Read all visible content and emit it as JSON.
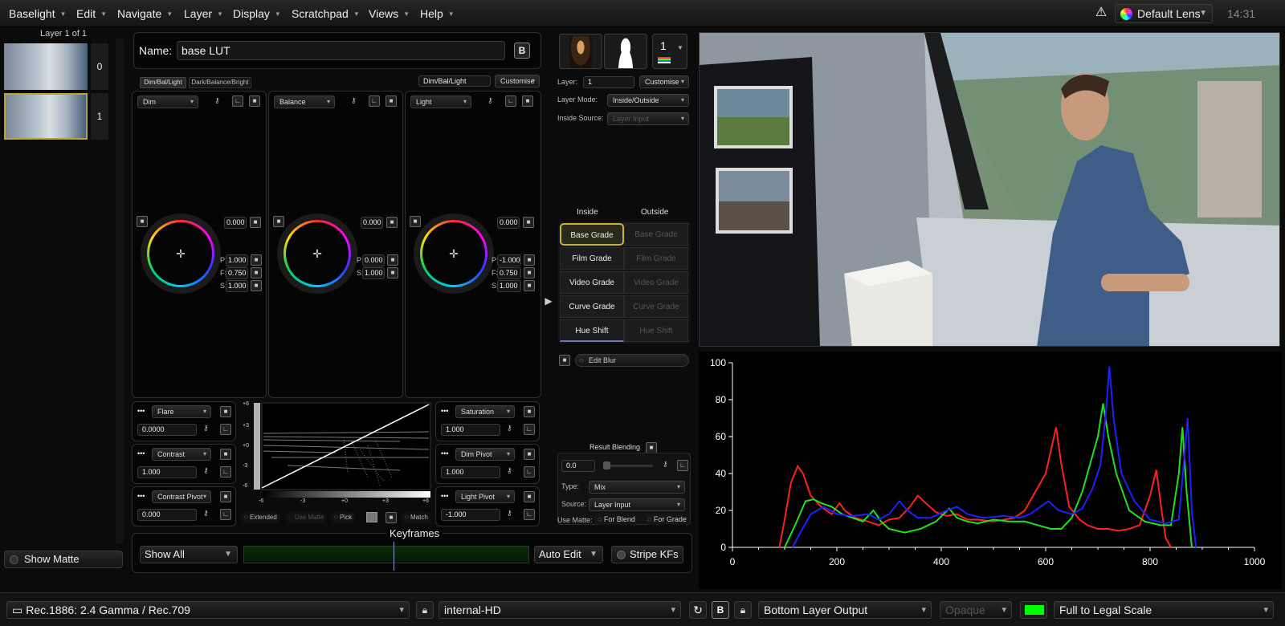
{
  "menubar": {
    "items": [
      "Baselight",
      "Edit",
      "Navigate",
      "Layer",
      "Display",
      "Scratchpad",
      "Views",
      "Help"
    ],
    "lens": "Default Lens",
    "clock": "14:31"
  },
  "layers": {
    "header": "Layer 1 of 1",
    "thumbs": [
      {
        "num": "0"
      },
      {
        "num": "1"
      }
    ],
    "show_matte": "Show Matte"
  },
  "name_field": {
    "label": "Name:",
    "value": "base LUT",
    "btn": "B"
  },
  "grade": {
    "tabs": [
      "Dim/Bal/Light",
      "Dark/Balance/Bright"
    ],
    "preset": "Dim/Bal/Light",
    "customise": "Customise",
    "wheels": [
      {
        "title": "Dim",
        "value": "0.000",
        "params": [
          {
            "k": "P:",
            "v": "1.000"
          },
          {
            "k": "F:",
            "v": "0.750"
          },
          {
            "k": "S:",
            "v": "1.000"
          }
        ]
      },
      {
        "title": "Balance",
        "value": "0.000",
        "params": [
          {
            "k": "P:",
            "v": "0.000"
          },
          {
            "k": "S:",
            "v": "1.000"
          }
        ]
      },
      {
        "title": "Light",
        "value": "0.000",
        "params": [
          {
            "k": "P:",
            "v": "-1.000"
          },
          {
            "k": "F:",
            "v": "0.750"
          },
          {
            "k": "S:",
            "v": "1.000"
          }
        ]
      }
    ],
    "left_params": [
      {
        "name": "Flare",
        "value": "0.0000"
      },
      {
        "name": "Contrast",
        "value": "1.000"
      },
      {
        "name": "Contrast Pivot",
        "value": "0.000"
      }
    ],
    "right_params": [
      {
        "name": "Saturation",
        "value": "1.000"
      },
      {
        "name": "Dim Pivot",
        "value": "1.000"
      },
      {
        "name": "Light Pivot",
        "value": "-1.000"
      }
    ],
    "curve": {
      "y_ticks": [
        "+6",
        "+3",
        "+0",
        "-3",
        "-6"
      ],
      "x_ticks": [
        "-6",
        "-3",
        "+0",
        "+3",
        "+6"
      ]
    },
    "curve_btns": [
      "Extended",
      "Use Matte",
      "Pick",
      "Match"
    ]
  },
  "keyframes": {
    "label": "Keyframes",
    "show": "Show All",
    "auto_edit": "Auto Edit",
    "stripe": "Stripe KFs"
  },
  "layer_panel": {
    "layer_label": "Layer:",
    "layer_value": "1",
    "customise": "Customise",
    "mode_label": "Layer Mode:",
    "mode_value": "Inside/Outside",
    "source_label": "Inside Source:",
    "source_value": "Layer Input",
    "inside": "Inside",
    "outside": "Outside",
    "grades": [
      "Base Grade",
      "Film Grade",
      "Video Grade",
      "Curve Grade",
      "Hue Shift"
    ],
    "layer_count": "1",
    "edit_blur": "Edit Blur",
    "result_blending": "Result Blending",
    "blend_value": "0.0",
    "type_label": "Type:",
    "type_value": "Mix",
    "src_label": "Source:",
    "src_value": "Layer Input",
    "use_matte": "Use Matte:",
    "for_blend": "For Blend",
    "for_grade": "For Grade"
  },
  "bottom": {
    "display": "Rec.1886: 2.4 Gamma / Rec.709",
    "format": "internal-HD",
    "output": "Bottom Layer Output",
    "opaque": "Opaque",
    "scale": "Full to Legal Scale",
    "bbtn": "B",
    "accent": "#00ff00"
  },
  "chart_data": {
    "type": "line",
    "xlim": [
      0,
      1000
    ],
    "ylim": [
      0,
      100
    ],
    "x_ticks": [
      0,
      200,
      400,
      600,
      800,
      1000
    ],
    "y_ticks": [
      0,
      20,
      40,
      60,
      80,
      100
    ],
    "series": [
      {
        "color": "#ff2020",
        "points": [
          [
            90,
            0
          ],
          [
            100,
            15
          ],
          [
            112,
            35
          ],
          [
            125,
            44
          ],
          [
            135,
            40
          ],
          [
            150,
            28
          ],
          [
            170,
            22
          ],
          [
            190,
            18
          ],
          [
            205,
            24
          ],
          [
            215,
            20
          ],
          [
            235,
            16
          ],
          [
            260,
            14
          ],
          [
            280,
            12
          ],
          [
            300,
            15
          ],
          [
            320,
            16
          ],
          [
            340,
            22
          ],
          [
            355,
            28
          ],
          [
            370,
            24
          ],
          [
            390,
            19
          ],
          [
            410,
            17
          ],
          [
            430,
            18
          ],
          [
            450,
            15
          ],
          [
            470,
            15
          ],
          [
            500,
            14
          ],
          [
            520,
            15
          ],
          [
            540,
            16
          ],
          [
            560,
            20
          ],
          [
            580,
            30
          ],
          [
            600,
            40
          ],
          [
            612,
            55
          ],
          [
            620,
            65
          ],
          [
            630,
            45
          ],
          [
            645,
            22
          ],
          [
            665,
            15
          ],
          [
            680,
            12
          ],
          [
            700,
            10
          ],
          [
            720,
            10
          ],
          [
            740,
            9
          ],
          [
            760,
            10
          ],
          [
            780,
            12
          ],
          [
            800,
            28
          ],
          [
            812,
            42
          ],
          [
            822,
            20
          ],
          [
            830,
            5
          ],
          [
            840,
            0
          ]
        ]
      },
      {
        "color": "#20e020",
        "points": [
          [
            100,
            0
          ],
          [
            120,
            12
          ],
          [
            140,
            25
          ],
          [
            155,
            26
          ],
          [
            170,
            24
          ],
          [
            190,
            22
          ],
          [
            210,
            18
          ],
          [
            230,
            16
          ],
          [
            250,
            14
          ],
          [
            270,
            20
          ],
          [
            285,
            14
          ],
          [
            300,
            10
          ],
          [
            330,
            8
          ],
          [
            360,
            10
          ],
          [
            390,
            14
          ],
          [
            415,
            21
          ],
          [
            430,
            16
          ],
          [
            450,
            14
          ],
          [
            470,
            13
          ],
          [
            500,
            15
          ],
          [
            530,
            14
          ],
          [
            560,
            14
          ],
          [
            585,
            12
          ],
          [
            610,
            10
          ],
          [
            630,
            10
          ],
          [
            650,
            16
          ],
          [
            670,
            30
          ],
          [
            690,
            50
          ],
          [
            700,
            60
          ],
          [
            710,
            78
          ],
          [
            720,
            60
          ],
          [
            735,
            40
          ],
          [
            760,
            20
          ],
          [
            790,
            14
          ],
          [
            820,
            12
          ],
          [
            840,
            12
          ],
          [
            855,
            40
          ],
          [
            862,
            65
          ],
          [
            870,
            30
          ],
          [
            880,
            0
          ]
        ]
      },
      {
        "color": "#2020ff",
        "points": [
          [
            115,
            0
          ],
          [
            130,
            8
          ],
          [
            150,
            18
          ],
          [
            175,
            22
          ],
          [
            200,
            18
          ],
          [
            230,
            17
          ],
          [
            260,
            18
          ],
          [
            280,
            15
          ],
          [
            300,
            18
          ],
          [
            320,
            25
          ],
          [
            335,
            20
          ],
          [
            355,
            16
          ],
          [
            380,
            16
          ],
          [
            410,
            20
          ],
          [
            430,
            22
          ],
          [
            450,
            18
          ],
          [
            480,
            16
          ],
          [
            520,
            17
          ],
          [
            550,
            16
          ],
          [
            570,
            18
          ],
          [
            590,
            22
          ],
          [
            605,
            25
          ],
          [
            625,
            20
          ],
          [
            650,
            18
          ],
          [
            670,
            21
          ],
          [
            690,
            32
          ],
          [
            705,
            45
          ],
          [
            715,
            72
          ],
          [
            722,
            98
          ],
          [
            730,
            70
          ],
          [
            745,
            40
          ],
          [
            770,
            25
          ],
          [
            800,
            15
          ],
          [
            830,
            13
          ],
          [
            855,
            15
          ],
          [
            866,
            50
          ],
          [
            872,
            70
          ],
          [
            880,
            20
          ],
          [
            888,
            0
          ]
        ]
      }
    ]
  }
}
